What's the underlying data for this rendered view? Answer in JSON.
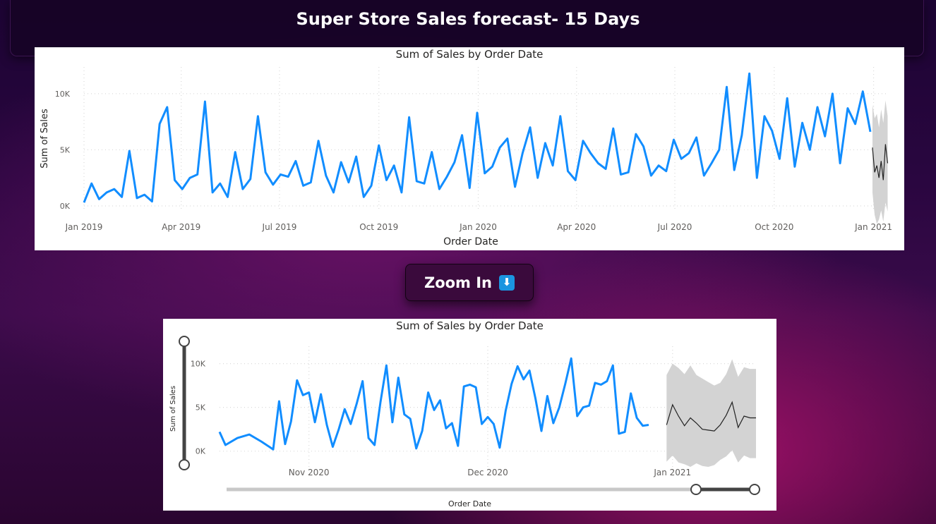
{
  "header": {
    "title": "Super Store Sales forecast- 15 Days"
  },
  "zoom_button": {
    "label": "Zoom In",
    "icon": "down-arrow-icon"
  },
  "colors": {
    "actual": "#118dff",
    "forecast": "#222222",
    "band": "#d3d3d3",
    "grid": "#d9d9d9"
  },
  "chart_data": [
    {
      "type": "line",
      "title": "Sum of Sales by Order Date",
      "xlabel": "Order Date",
      "ylabel": "Sum of Sales",
      "x_tick_labels": [
        "Jan 2019",
        "Apr 2019",
        "Jul 2019",
        "Oct 2019",
        "Jan 2020",
        "Apr 2020",
        "Jul 2020",
        "Oct 2020",
        "Jan 2021"
      ],
      "y_tick_labels": [
        "10K",
        "5K",
        "0K"
      ],
      "y_ticks": [
        10000,
        5000,
        0
      ],
      "ylim": [
        0,
        12000
      ],
      "x": [
        "2019-01-01",
        "2019-01-08",
        "2019-01-15",
        "2019-01-22",
        "2019-01-29",
        "2019-02-05",
        "2019-02-12",
        "2019-02-19",
        "2019-02-26",
        "2019-03-05",
        "2019-03-12",
        "2019-03-19",
        "2019-03-26",
        "2019-04-02",
        "2019-04-09",
        "2019-04-16",
        "2019-04-23",
        "2019-04-30",
        "2019-05-07",
        "2019-05-14",
        "2019-05-21",
        "2019-05-28",
        "2019-06-04",
        "2019-06-11",
        "2019-06-18",
        "2019-06-25",
        "2019-07-02",
        "2019-07-09",
        "2019-07-16",
        "2019-07-23",
        "2019-07-30",
        "2019-08-06",
        "2019-08-13",
        "2019-08-20",
        "2019-08-27",
        "2019-09-03",
        "2019-09-10",
        "2019-09-17",
        "2019-09-24",
        "2019-10-01",
        "2019-10-08",
        "2019-10-15",
        "2019-10-22",
        "2019-10-29",
        "2019-11-05",
        "2019-11-12",
        "2019-11-19",
        "2019-11-26",
        "2019-12-03",
        "2019-12-10",
        "2019-12-17",
        "2019-12-24",
        "2019-12-31",
        "2020-01-07",
        "2020-01-14",
        "2020-01-21",
        "2020-01-28",
        "2020-02-04",
        "2020-02-11",
        "2020-02-18",
        "2020-02-25",
        "2020-03-03",
        "2020-03-10",
        "2020-03-17",
        "2020-03-24",
        "2020-03-31",
        "2020-04-07",
        "2020-04-14",
        "2020-04-21",
        "2020-04-28",
        "2020-05-05",
        "2020-05-12",
        "2020-05-19",
        "2020-05-26",
        "2020-06-02",
        "2020-06-09",
        "2020-06-16",
        "2020-06-23",
        "2020-06-30",
        "2020-07-07",
        "2020-07-14",
        "2020-07-21",
        "2020-07-28",
        "2020-08-04",
        "2020-08-11",
        "2020-08-18",
        "2020-08-25",
        "2020-09-01",
        "2020-09-08",
        "2020-09-15",
        "2020-09-22",
        "2020-09-29",
        "2020-10-06",
        "2020-10-13",
        "2020-10-20",
        "2020-10-27",
        "2020-11-03",
        "2020-11-10",
        "2020-11-17",
        "2020-11-24",
        "2020-12-01",
        "2020-12-08",
        "2020-12-15",
        "2020-12-22",
        "2020-12-29"
      ],
      "series": [
        {
          "values": [
            300,
            2000,
            600,
            1200,
            1500,
            800,
            4900,
            700,
            1000,
            400,
            7300,
            8800,
            2300,
            1500,
            2500,
            2800,
            9300,
            1200,
            2000,
            800,
            4800,
            1500,
            2400,
            8000,
            3000,
            1900,
            2800,
            2600,
            4000,
            1800,
            2100,
            5800,
            2700,
            1200,
            3900,
            2100,
            4400,
            800,
            1800,
            5400,
            2300,
            3600,
            1200,
            7900,
            2200,
            2000,
            4800,
            1500,
            2600,
            3900,
            6300,
            1600,
            8300,
            2900,
            3500,
            5200,
            6000,
            1700,
            4700,
            7000,
            2500,
            5600,
            3600,
            8000,
            3100,
            2300,
            5800,
            4700,
            3800,
            3300,
            6900,
            2800,
            3000,
            6400,
            5300,
            2700,
            3600,
            3100,
            5900,
            4200,
            4700,
            6100,
            2700,
            3800,
            5000,
            10600,
            3200,
            6300,
            11800,
            2500,
            8000,
            6700,
            4200,
            9600,
            3500,
            7400,
            5000,
            8800,
            6200,
            10000,
            3800,
            8700,
            7300,
            10200,
            6600
          ]
        }
      ],
      "forecast": {
        "x": [
          "2020-12-31",
          "2021-01-02",
          "2021-01-04",
          "2021-01-06",
          "2021-01-08",
          "2021-01-10",
          "2021-01-12",
          "2021-01-14"
        ],
        "values": [
          5200,
          3000,
          3600,
          2500,
          4000,
          2300,
          5500,
          3800
        ],
        "upper": [
          9000,
          7800,
          8200,
          7000,
          8600,
          7400,
          9400,
          8000
        ],
        "lower": [
          1200,
          -800,
          -1600,
          -1200,
          -400,
          -1400,
          300,
          -500
        ]
      }
    },
    {
      "type": "line",
      "title": "Sum of Sales by Order Date",
      "xlabel": "Order Date",
      "ylabel": "Sum of Sales",
      "x_tick_labels": [
        "Nov 2020",
        "Dec 2020",
        "Jan 2021"
      ],
      "y_tick_labels": [
        "10K",
        "5K",
        "0K"
      ],
      "y_ticks": [
        10000,
        5000,
        0
      ],
      "ylim": [
        -1800,
        11500
      ],
      "x": [
        "2020-10-17",
        "2020-10-18",
        "2020-10-20",
        "2020-10-22",
        "2020-10-24",
        "2020-10-26",
        "2020-10-27",
        "2020-10-28",
        "2020-10-29",
        "2020-10-30",
        "2020-10-31",
        "2020-11-01",
        "2020-11-02",
        "2020-11-03",
        "2020-11-04",
        "2020-11-05",
        "2020-11-06",
        "2020-11-07",
        "2020-11-08",
        "2020-11-09",
        "2020-11-10",
        "2020-11-11",
        "2020-11-12",
        "2020-11-13",
        "2020-11-14",
        "2020-11-15",
        "2020-11-16",
        "2020-11-17",
        "2020-11-18",
        "2020-11-19",
        "2020-11-20",
        "2020-11-21",
        "2020-11-22",
        "2020-11-23",
        "2020-11-24",
        "2020-11-25",
        "2020-11-26",
        "2020-11-27",
        "2020-11-28",
        "2020-11-29",
        "2020-11-30",
        "2020-12-01",
        "2020-12-02",
        "2020-12-03",
        "2020-12-04",
        "2020-12-05",
        "2020-12-06",
        "2020-12-07",
        "2020-12-08",
        "2020-12-09",
        "2020-12-10",
        "2020-12-11",
        "2020-12-12",
        "2020-12-13",
        "2020-12-14",
        "2020-12-15",
        "2020-12-16",
        "2020-12-17",
        "2020-12-18",
        "2020-12-19",
        "2020-12-20",
        "2020-12-21",
        "2020-12-22",
        "2020-12-23",
        "2020-12-24",
        "2020-12-25",
        "2020-12-26",
        "2020-12-27",
        "2020-12-28",
        "2020-12-29",
        "2020-12-30",
        "2020-12-31"
      ],
      "series": [
        {
          "values": [
            2200,
            700,
            1500,
            1900,
            1100,
            200,
            5700,
            800,
            3400,
            8100,
            6400,
            6700,
            3300,
            6500,
            3000,
            500,
            2500,
            4800,
            3100,
            5400,
            8000,
            1500,
            700,
            5600,
            9800,
            3300,
            8400,
            4200,
            3700,
            300,
            2300,
            6700,
            4700,
            5800,
            2600,
            3200,
            600,
            7400,
            7600,
            7300,
            3100,
            3900,
            3100,
            400,
            4600,
            7700,
            9700,
            8200,
            9200,
            6000,
            2300,
            6300,
            3200,
            5000,
            7700,
            10600,
            4000,
            5000,
            5200,
            7800,
            7600,
            8000,
            9800,
            2000,
            2200,
            6600,
            3800,
            2900,
            3000,
            null,
            null,
            null
          ]
        }
      ],
      "forecast": {
        "x": [
          "2020-12-31",
          "2021-01-01",
          "2021-01-02",
          "2021-01-03",
          "2021-01-04",
          "2021-01-05",
          "2021-01-06",
          "2021-01-07",
          "2021-01-08",
          "2021-01-09",
          "2021-01-10",
          "2021-01-11",
          "2021-01-12",
          "2021-01-13",
          "2021-01-14",
          "2021-01-15"
        ],
        "values": [
          3000,
          5300,
          4000,
          2900,
          3800,
          3200,
          2500,
          2400,
          2300,
          3000,
          4100,
          5600,
          2700,
          4000,
          3800,
          3800
        ],
        "upper": [
          8700,
          10000,
          9500,
          8800,
          9800,
          8700,
          8300,
          7900,
          7500,
          7800,
          8800,
          10500,
          8500,
          9600,
          9400,
          9400
        ],
        "lower": [
          -1200,
          -500,
          -1300,
          -1500,
          -1800,
          -1400,
          -1700,
          -1800,
          -1600,
          -1000,
          -600,
          100,
          -1300,
          -500,
          -800,
          -800
        ]
      }
    }
  ]
}
